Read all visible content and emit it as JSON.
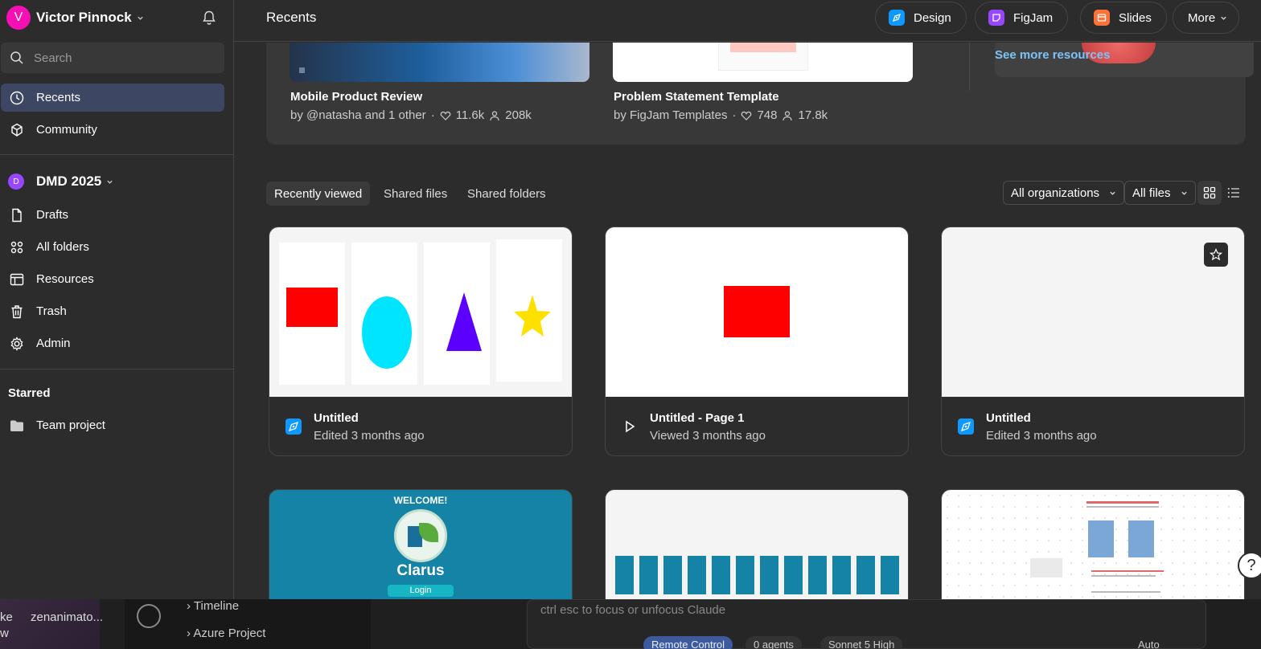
{
  "sidebar": {
    "user": {
      "initial": "V",
      "name": "Victor Pinnock"
    },
    "search_placeholder": "Search",
    "top_items": [
      {
        "label": "Recents",
        "icon": "clock-icon",
        "active": true
      },
      {
        "label": "Community",
        "icon": "community-icon",
        "active": false
      }
    ],
    "team": {
      "initial": "D",
      "name": "DMD 2025"
    },
    "team_items": [
      {
        "label": "Drafts",
        "icon": "file-icon"
      },
      {
        "label": "All folders",
        "icon": "grid-icon"
      },
      {
        "label": "Resources",
        "icon": "resources-icon"
      },
      {
        "label": "Trash",
        "icon": "trash-icon"
      },
      {
        "label": "Admin",
        "icon": "gear-icon"
      }
    ],
    "starred_label": "Starred",
    "starred_items": [
      {
        "label": "Team project",
        "icon": "folder-icon"
      }
    ]
  },
  "header": {
    "title": "Recents",
    "buttons": [
      {
        "label": "Design",
        "color": "#0d99ff"
      },
      {
        "label": "FigJam",
        "color": "#9747ff"
      },
      {
        "label": "Slides",
        "color": "#ff7237"
      },
      {
        "label": "More"
      }
    ]
  },
  "resources": [
    {
      "title": "Mobile Product Review",
      "by": "by @natasha and 1 other",
      "likes": "11.6k",
      "users": "208k"
    },
    {
      "title": "Problem Statement Template",
      "by": "by FigJam Templates",
      "likes": "748",
      "users": "17.8k"
    }
  ],
  "see_more": "See more resources",
  "tabs": [
    {
      "label": "Recently viewed",
      "active": true
    },
    {
      "label": "Shared files",
      "active": false
    },
    {
      "label": "Shared folders",
      "active": false
    }
  ],
  "filters": {
    "org": "All organizations",
    "files": "All files"
  },
  "files": [
    {
      "title": "Untitled",
      "subtitle": "Edited 3 months ago",
      "icon": "design-file-icon"
    },
    {
      "title": "Untitled - Page 1",
      "subtitle": "Viewed 3 months ago",
      "icon": "play-icon"
    },
    {
      "title": "Untitled",
      "subtitle": "Edited 3 months ago",
      "icon": "design-file-icon"
    }
  ],
  "file_row2": {
    "welcome": "WELCOME!",
    "app_name": "Clarus",
    "login": "Login"
  },
  "help": "?",
  "taskbar": {
    "left_a": "ke",
    "left_b": "zenanimato...",
    "left_c": "w",
    "tree_items": [
      "Timeline",
      "Azure Project"
    ],
    "cmd_placeholder": "ctrl esc to focus or unfocus Claude",
    "chips": [
      "Remote Control",
      "0 agents",
      "Sonnet 5 High",
      "Auto"
    ]
  }
}
